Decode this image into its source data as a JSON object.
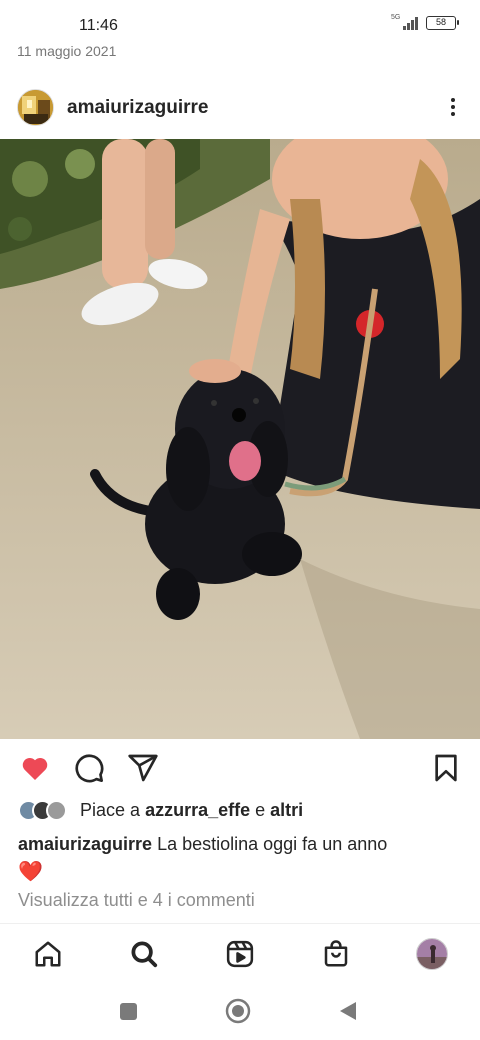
{
  "status_bar": {
    "time": "11:46",
    "network": "5G",
    "battery": "58"
  },
  "post": {
    "date": "11 maggio 2021",
    "username": "amaiurizaguirre",
    "liked": true,
    "likes": {
      "prefix": "Piace a",
      "user": "azzurra_effe",
      "conjunction": "e",
      "others": "altri"
    },
    "caption": {
      "username": "amaiurizaguirre",
      "text": "La bestiolina oggi fa un anno",
      "emoji": "❤️"
    },
    "comments_link": "Visualizza tutti e 4 i commenti"
  },
  "icons": {
    "like": "heart-icon",
    "comment": "comment-icon",
    "share": "paper-plane-icon",
    "save": "bookmark-icon",
    "more": "more-vertical-icon",
    "nav_home": "home-icon",
    "nav_search": "search-icon",
    "nav_reels": "reels-icon",
    "nav_shop": "shopping-bag-icon",
    "sys_recents": "square-icon",
    "sys_home": "circle-icon",
    "sys_back": "back-triangle-icon"
  },
  "colors": {
    "like_red": "#ed4956",
    "text": "#262626",
    "muted": "#8e8e8e"
  }
}
